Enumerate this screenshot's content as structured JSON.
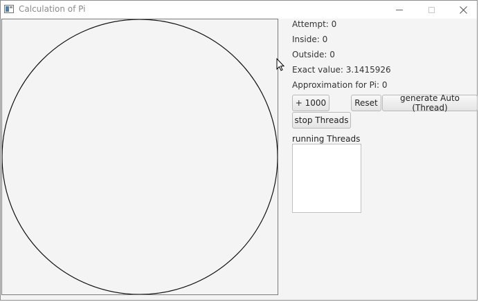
{
  "window": {
    "title": "Calculation of Pi"
  },
  "stats": {
    "attempt": "Attempt: 0",
    "inside": "Inside: 0",
    "outside": "Outside: 0",
    "exact_value": "Exact value: 3.1415926",
    "approximation": "Approximation for Pi: 0"
  },
  "buttons": {
    "plus_1000": "+ 1000",
    "reset": "Reset",
    "generate_auto": "generate Auto (Thread)",
    "stop_threads": "stop Threads"
  },
  "threads": {
    "label": "running Threads",
    "items": []
  },
  "icons": {
    "app": "app-window-icon",
    "minimize": "minimize-icon",
    "maximize": "maximize-icon",
    "close": "close-icon",
    "cursor": "mouse-pointer-icon"
  }
}
